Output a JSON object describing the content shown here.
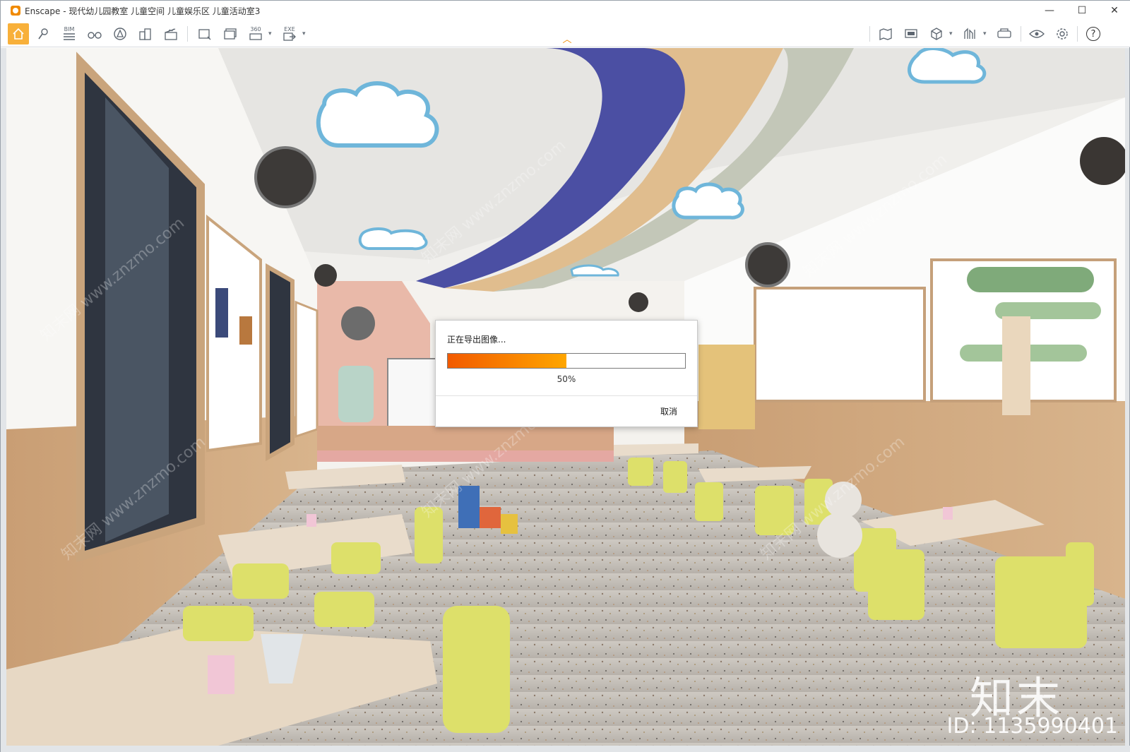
{
  "window": {
    "title": "Enscape - 现代幼儿园教室 儿童空间 儿童娱乐区 儿童活动室3",
    "controls": {
      "minimize": "—",
      "maximize": "☐",
      "close": "✕"
    }
  },
  "toolbar": {
    "left_icons": [
      "home-icon",
      "pencil-draw-icon",
      "bim-icon",
      "binoculars-icon",
      "asset-library-icon",
      "buildings-icon",
      "clapper-icon",
      "screenshot-icon",
      "batch-render-icon",
      "panorama-360-icon",
      "exe-export-icon"
    ],
    "bim_label": "BIM",
    "pano_label": "360",
    "exe_label": "EXE",
    "right_icons": [
      "map-icon",
      "slideshow-icon",
      "cube-icon",
      "sections-icon",
      "vr-headset-icon",
      "eye-icon",
      "settings-icon",
      "help-icon"
    ],
    "help_label": "?"
  },
  "dialog": {
    "title": "正在导出图像...",
    "progress_value": 0.5,
    "progress_text": "50%",
    "cancel_label": "取消"
  },
  "overlay": {
    "brand": "知末",
    "id": "ID: 1135990401",
    "watermark": "知末网 www.znzmo.com"
  },
  "colors": {
    "accent": "#f08a00",
    "progress_start": "#f25a00",
    "progress_end": "#ffa600"
  }
}
